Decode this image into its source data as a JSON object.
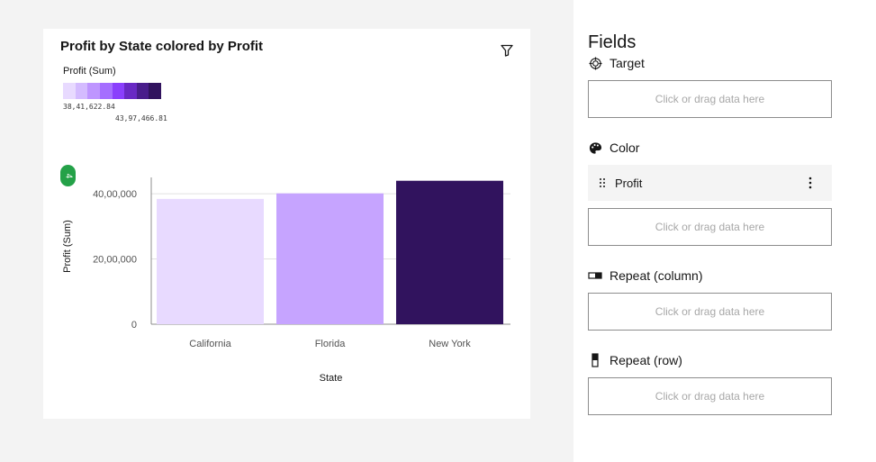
{
  "card": {
    "title": "Profit by State colored by Profit",
    "legend": {
      "title": "Profit (Sum)",
      "min_label": "38,41,622.84",
      "max_label": "43,97,466.81",
      "colors": [
        "#e8daff",
        "#d4bbff",
        "#be95ff",
        "#a56eff",
        "#8a3ffc",
        "#6929c4",
        "#491d8b",
        "#31135e"
      ]
    },
    "count_badge": "4"
  },
  "chart_data": {
    "type": "bar",
    "categories": [
      "California",
      "Florida",
      "New York"
    ],
    "values": [
      3841622.84,
      4010000,
      4397466.81
    ],
    "colors": [
      "#e8daff",
      "#c6a4ff",
      "#31135e"
    ],
    "title": "Profit by State colored by Profit",
    "xlabel": "State",
    "ylabel": "Profit (Sum)",
    "ylim": [
      0,
      4500000
    ],
    "yticks": [
      0,
      2000000,
      4000000
    ],
    "ytick_labels": [
      "0",
      "20,00,000",
      "40,00,000"
    ],
    "grid": true
  },
  "fields": {
    "title": "Fields",
    "drop_placeholder": "Click or drag data here",
    "sections": [
      {
        "label": "Target",
        "icon": "target-icon"
      },
      {
        "label": "Color",
        "icon": "palette-icon",
        "field": "Profit"
      },
      {
        "label": "Repeat (column)",
        "icon": "repeat-column-icon"
      },
      {
        "label": "Repeat (row)",
        "icon": "repeat-row-icon"
      }
    ]
  }
}
